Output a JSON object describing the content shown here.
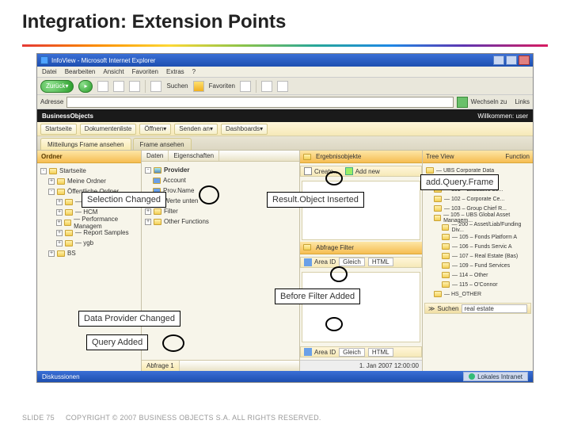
{
  "slide": {
    "title": "Integration: Extension Points",
    "number": "SLIDE 75",
    "copyright": "COPYRIGHT © 2007 BUSINESS OBJECTS S.A.  ALL RIGHTS RESERVED."
  },
  "window": {
    "title": "InfoView - Microsoft Internet Explorer"
  },
  "menu": {
    "file": "Datei",
    "edit": "Bearbeiten",
    "view": "Ansicht",
    "fav": "Favoriten",
    "extras": "Extras",
    "help": "?"
  },
  "toolbar": {
    "back": "Zurück",
    "forward": "",
    "favorites": "Favoriten",
    "search": "Suchen"
  },
  "addr": {
    "label": "Adresse",
    "go": "Wechseln zu",
    "links": "Links"
  },
  "bo": {
    "brand": "BusinessObjects",
    "welcome": "Willkommen:",
    "user": "user"
  },
  "apptb": {
    "home": "Startseite",
    "nav": "Dokumentenliste",
    "open": "Öffnen",
    "send": "Senden an",
    "dash": "Dashboards"
  },
  "tabs": {
    "t1": "Mitteilungs Frame ansehen",
    "t2": "Frame ansehen"
  },
  "left": {
    "header": "Ordner",
    "root": "Startseite",
    "items": [
      "Meine Ordner",
      "Öffentliche Ordner",
      "— H BOCP",
      "— HCM",
      "— Performance Managem",
      "— Report Samples",
      "— ygb",
      "BS"
    ]
  },
  "mid": {
    "tab_data": "Daten",
    "tab_prop": "Eigenschaften",
    "group": "Provider",
    "item_account": "Account",
    "item_provname": "Prov.Name",
    "sec_values": "Werte unten",
    "sec_filter": "Filter",
    "sec_other": "Other Functions"
  },
  "right": {
    "tabstrip": {
      "t1": "Ergebnisobjekte",
      "t2": ""
    },
    "btn_create": "Create...",
    "btn_addnew": "Add new",
    "sec_abfrage": "Abfrage Filter",
    "field_area": "Area ID",
    "field_gleich": "Gleich",
    "field_type": "HTML",
    "bottom_search": "Suchen",
    "bottom_val": "real estate",
    "date": "1. Jan 2007 12:00:00"
  },
  "rside": {
    "head": "Tree View",
    "col": "Function",
    "items": [
      "— UBS Corporate Data",
      "— 001 – UBS AG",
      "— 101 – Executive bo...",
      "— 102 – Corporate Ce...",
      "— 103 – Group Chief R...",
      "— 105 – UBS Global Asset Managem...",
      "— 200 – Asset/Liab/Funding Div...",
      "— 105 – Fonds Platform A",
      "— 106 – Funds Servic A",
      "— 107 – Real Estate (Bas)",
      "— 109 – Fund Services",
      "— 114 – Other",
      "— 115 – O'Connor",
      "— HS_OTHER"
    ]
  },
  "status": {
    "label": "Diskussionen",
    "net": "Lokales Intranet"
  },
  "callouts": {
    "selChanged": "Selection Changed",
    "resultInserted": "Result.Object Inserted",
    "addQueryFrame": "add.Query.Frame",
    "beforeFilter": "Before Filter Added",
    "dataProvider": "Data Provider Changed",
    "queryAdded": "Query Added"
  }
}
